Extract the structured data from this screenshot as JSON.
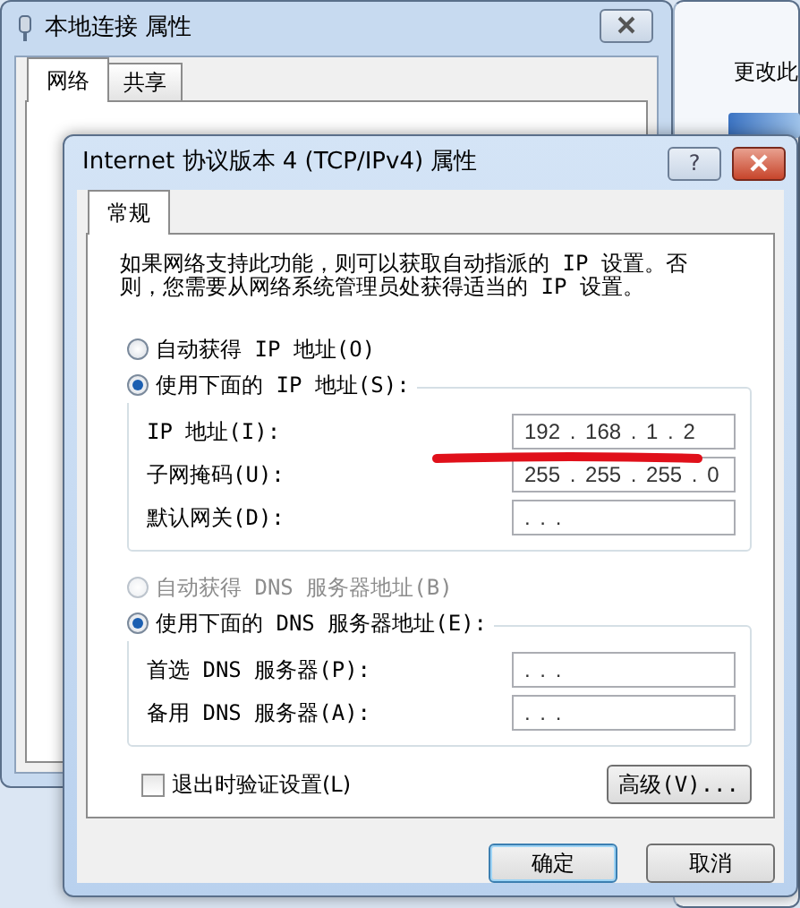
{
  "background_window": {
    "title": "本地连接 属性",
    "tabs": [
      {
        "label": "网络",
        "selected": true
      },
      {
        "label": "共享",
        "selected": false
      }
    ]
  },
  "behind_window": {
    "toolbar_text": "更改此"
  },
  "dialog": {
    "title": "Internet 协议版本 4 (TCP/IPv4) 属性",
    "help_button": "?",
    "tabs": [
      {
        "label": "常规",
        "selected": true
      }
    ],
    "description": "如果网络支持此功能，则可以获取自动指派的 IP 设置。否则，您需要从网络系统管理员处获得适当的 IP 设置。",
    "ip_options": [
      {
        "label": "自动获得 IP 地址(O)",
        "selected": false,
        "disabled": false
      },
      {
        "label": "使用下面的 IP 地址(S):",
        "selected": true,
        "disabled": false
      }
    ],
    "ip_fields": [
      {
        "label": "IP 地址(I):",
        "value": "192 . 168 . 1 . 2"
      },
      {
        "label": "子网掩码(U):",
        "value": "255 . 255 . 255 . 0"
      },
      {
        "label": "默认网关(D):",
        "value": ". . ."
      }
    ],
    "dns_options": [
      {
        "label": "自动获得 DNS 服务器地址(B)",
        "selected": false,
        "disabled": true
      },
      {
        "label": "使用下面的 DNS 服务器地址(E):",
        "selected": true,
        "disabled": false
      }
    ],
    "dns_fields": [
      {
        "label": "首选 DNS 服务器(P):",
        "value": ". . ."
      },
      {
        "label": "备用 DNS 服务器(A):",
        "value": ". . ."
      }
    ],
    "validate_on_exit": {
      "label": "退出时验证设置(L)",
      "checked": false
    },
    "advanced_button": "高级(V)...",
    "buttons": [
      {
        "label": "确定",
        "default": true
      },
      {
        "label": "取消",
        "default": false
      }
    ]
  }
}
